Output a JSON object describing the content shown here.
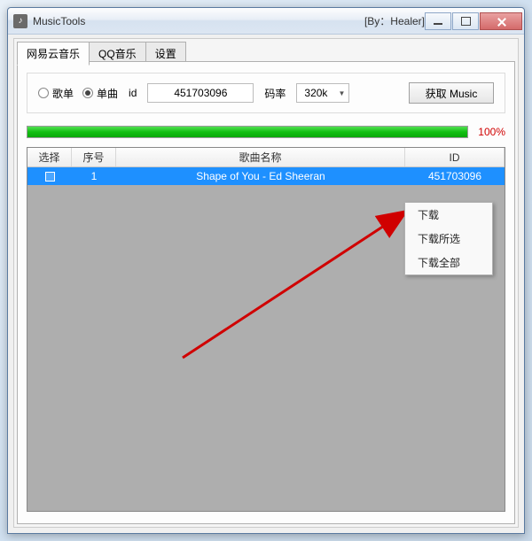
{
  "window": {
    "title": "MusicTools",
    "title_extra": "[By：Healer]"
  },
  "tabs": {
    "items": [
      {
        "label": "网易云音乐",
        "active": true
      },
      {
        "label": "QQ音乐",
        "active": false
      },
      {
        "label": "设置",
        "active": false
      }
    ]
  },
  "controls": {
    "radio_list": "歌单",
    "radio_single": "单曲",
    "id_label": "id",
    "id_value": "451703096",
    "bitrate_label": "码率",
    "bitrate_value": "320k",
    "get_button": "获取 Music"
  },
  "progress": {
    "percent_text": "100%",
    "fill_pct": 100
  },
  "grid": {
    "headers": {
      "select": "选择",
      "index": "序号",
      "name": "歌曲名称",
      "id": "ID"
    },
    "rows": [
      {
        "index": "1",
        "name": "Shape of You - Ed Sheeran",
        "id": "451703096",
        "selected": true
      }
    ]
  },
  "context_menu": {
    "items": [
      {
        "label": "下载"
      },
      {
        "label": "下载所选"
      },
      {
        "label": "下载全部"
      }
    ]
  }
}
